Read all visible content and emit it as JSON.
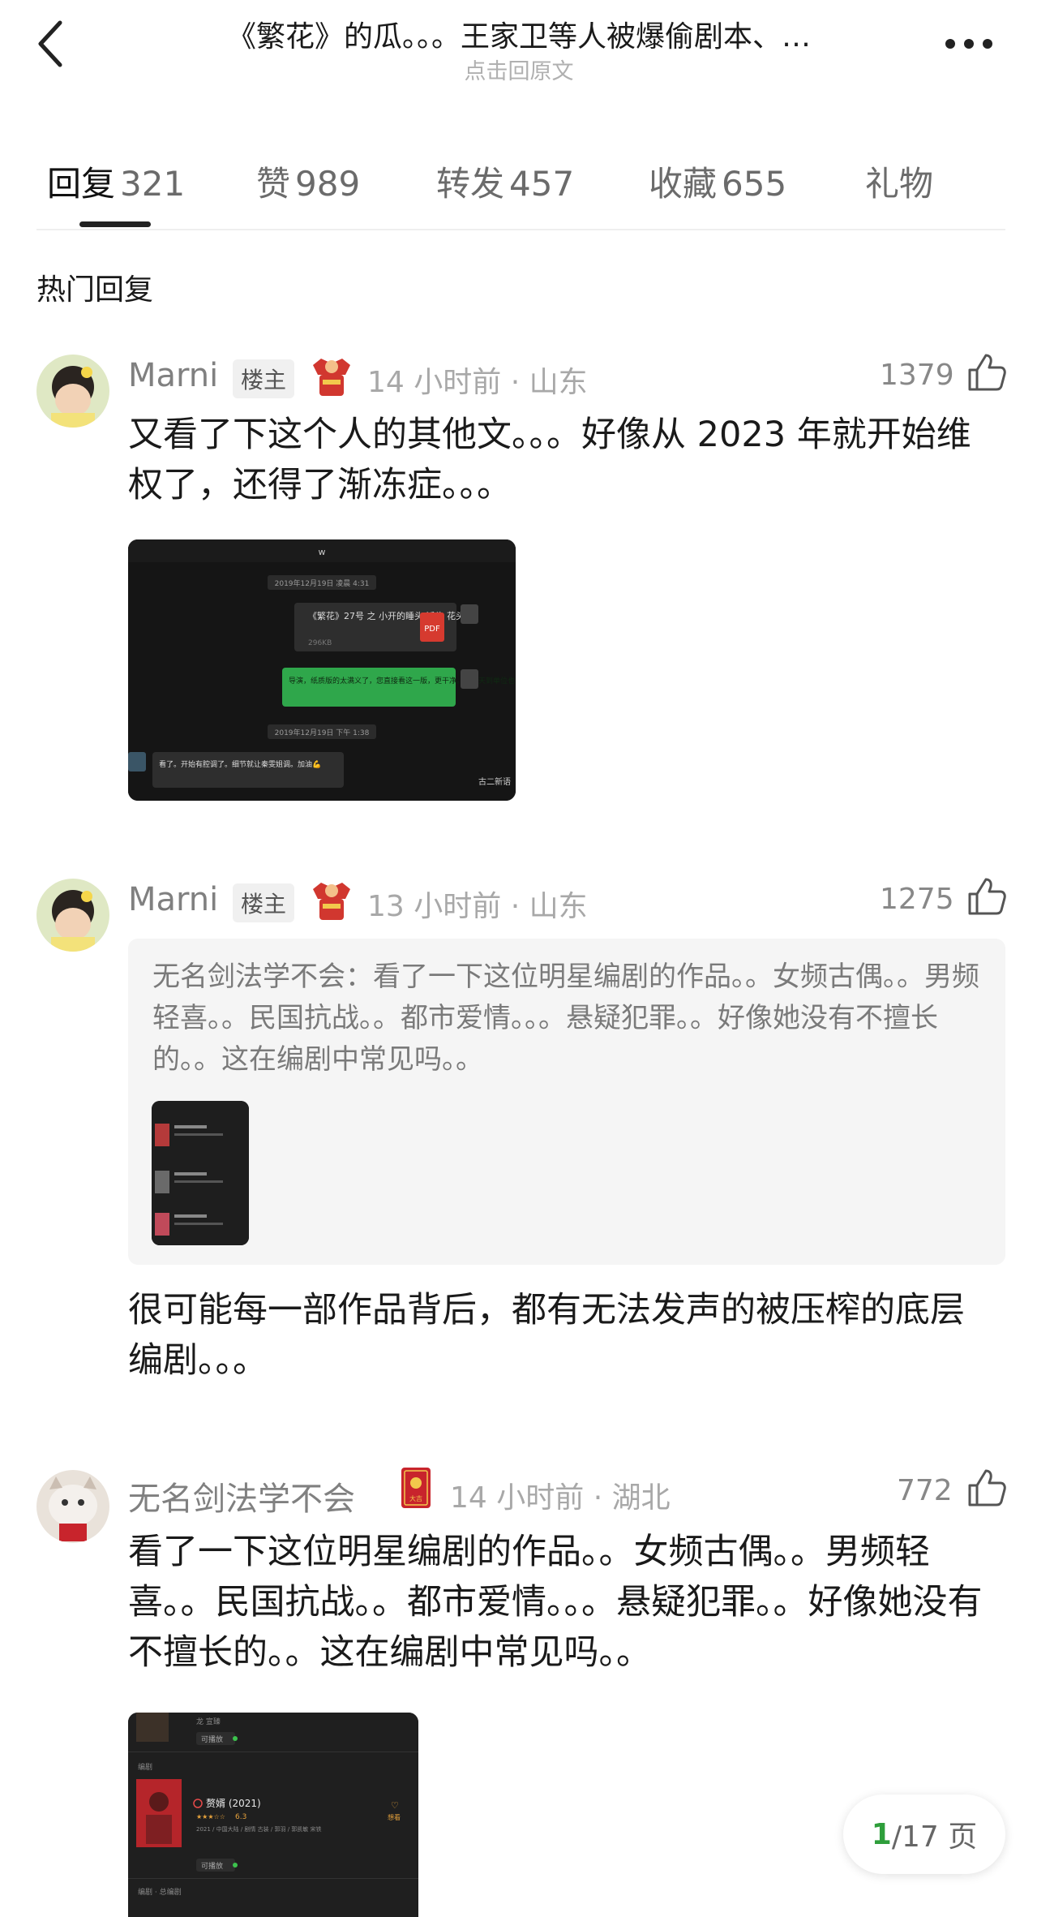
{
  "header": {
    "title": "《繁花》的瓜。。。王家卫等人被爆偷剧本、…",
    "subtitle": "点击回原文"
  },
  "tabs": [
    {
      "label": "回复",
      "count": "321"
    },
    {
      "label": "赞",
      "count": "989"
    },
    {
      "label": "转发",
      "count": "457"
    },
    {
      "label": "收藏",
      "count": "655"
    },
    {
      "label": "礼物",
      "count": ""
    }
  ],
  "section_title": "热门回复",
  "comments": [
    {
      "username": "Marni",
      "badge": "楼主",
      "time_location": "14 小时前 · 山东",
      "likes": "1379",
      "text": "又看了下这个人的其他文。。。好像从 2023 年就开始维权了，还得了渐冻症。。。",
      "image": {
        "header_letter": "w",
        "timestamp1": "2019年12月19日 凌晨 4:31",
        "file_title": "《繁花》27号 之 小开的睡头 派头 花头...",
        "file_size": "296KB",
        "file_type": "PDF",
        "green_msg": "导演，纸质版的太满义了，您直接看这一版，更干净。我明天到单位也会打印出来。",
        "timestamp2": "2019年12月19日 下午 1:38",
        "reply_msg": "看了。开始有腔调了。细节就让秦雯姐调。加油💪",
        "watermark": "古二新语"
      }
    },
    {
      "username": "Marni",
      "badge": "楼主",
      "time_location": "13 小时前 · 山东",
      "likes": "1275",
      "quote": "无名剑法学不会：看了一下这位明星编剧的作品。。女频古偶。。男频轻喜。。民国抗战。。都市爱情。。。悬疑犯罪。。好像她没有不擅长的。。这在编剧中常见吗。。",
      "text": "很可能每一部作品背后，都有无法发声的被压榨的底层编剧。。。"
    },
    {
      "username": "无名剑法学不会",
      "badge_text": "大吉",
      "time_location": "14 小时前 · 湖北",
      "likes": "772",
      "text": "看了一下这位明星编剧的作品。。女频古偶。。男频轻喜。。民国抗战。。都市爱情。。。悬疑犯罪。。好像她没有不擅长的。。这在编剧中常见吗。。",
      "image": {
        "top_label": "龙 宣臻",
        "playable_1": "可播放",
        "section_label": "编剧",
        "movie_title": "赘婿 (2021)",
        "rating": "6.3",
        "movie_info": "2021 / 中国大陆 / 剧情 古装 / 郭羽 / 郭凯敏 宋铁",
        "want_label": "想看",
        "playable_2": "可播放",
        "bottom_label": "编剧 · 总编剧"
      }
    }
  ],
  "pager": {
    "current": "1",
    "total_text": "/17 页"
  },
  "colors": {
    "accent_green": "#2e9e3b",
    "wechat_green": "#2fa74b",
    "medal_red": "#c8242c"
  }
}
